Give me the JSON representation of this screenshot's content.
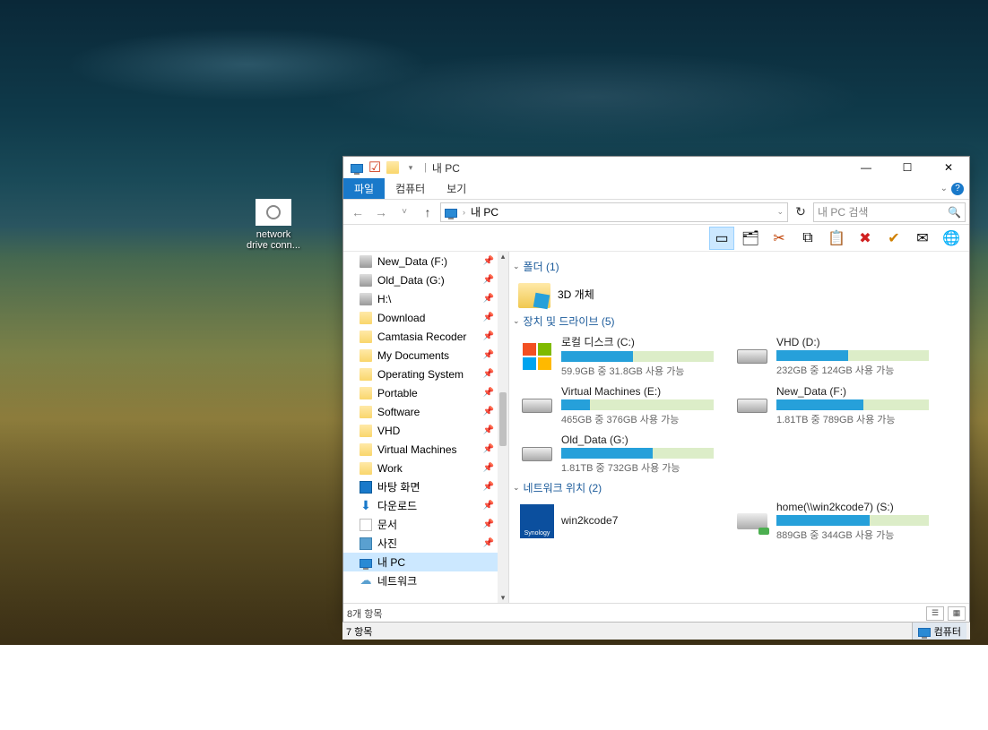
{
  "desktop": {
    "shortcut": {
      "label": "network\ndrive conn..."
    }
  },
  "window": {
    "title": "내 PC",
    "controls": {
      "min": "—",
      "max": "☐",
      "close": "✕"
    }
  },
  "ribbon": {
    "tabs": {
      "file": "파일",
      "computer": "컴퓨터",
      "view": "보기"
    }
  },
  "nav": {
    "back": "←",
    "forward": "→",
    "recent_chev": "˅",
    "up": "↑",
    "breadcrumb": "내 PC",
    "refresh": "↻",
    "search_placeholder": "내 PC 검색",
    "search_icon": "🔍"
  },
  "toolbar_icons": {
    "preview": "▭",
    "organize": "🗂",
    "cut": "✂",
    "copy": "⧉",
    "paste": "📋",
    "delete": "✖",
    "rename": "✔",
    "properties": "✉",
    "web": "🌐"
  },
  "sidebar": {
    "items": [
      {
        "label": "New_Data (F:)",
        "icon": "drive",
        "pin": true
      },
      {
        "label": "Old_Data (G:)",
        "icon": "drive",
        "pin": true
      },
      {
        "label": "H:\\",
        "icon": "drive",
        "pin": true
      },
      {
        "label": "Download",
        "icon": "folder",
        "pin": true
      },
      {
        "label": "Camtasia Recoder",
        "icon": "folder",
        "pin": true
      },
      {
        "label": "My Documents",
        "icon": "folder",
        "pin": true
      },
      {
        "label": "Operating System",
        "icon": "folder",
        "pin": true
      },
      {
        "label": "Portable",
        "icon": "folder",
        "pin": true
      },
      {
        "label": "Software",
        "icon": "folder",
        "pin": true
      },
      {
        "label": "VHD",
        "icon": "folder",
        "pin": true
      },
      {
        "label": "Virtual Machines",
        "icon": "folder",
        "pin": true
      },
      {
        "label": "Work",
        "icon": "folder",
        "pin": true
      },
      {
        "label": "바탕 화면",
        "icon": "desktop",
        "pin": true
      },
      {
        "label": "다운로드",
        "icon": "download",
        "pin": true
      },
      {
        "label": "문서",
        "icon": "doc",
        "pin": true
      },
      {
        "label": "사진",
        "icon": "pic",
        "pin": true
      },
      {
        "label": "내 PC",
        "icon": "pc",
        "pin": false,
        "selected": true
      },
      {
        "label": "네트워크",
        "icon": "net",
        "pin": false
      }
    ]
  },
  "content": {
    "groups": {
      "folders": {
        "title": "폴더 (1)",
        "items": [
          {
            "label": "3D 개체"
          }
        ]
      },
      "drives": {
        "title": "장치 및 드라이브 (5)",
        "items": [
          {
            "name": "로컬 디스크 (C:)",
            "stat": "59.9GB 중 31.8GB 사용 가능",
            "fill": 47,
            "icon": "win"
          },
          {
            "name": "VHD (D:)",
            "stat": "232GB 중 124GB 사용 가능",
            "fill": 47,
            "icon": "hdd"
          },
          {
            "name": "Virtual Machines (E:)",
            "stat": "465GB 중 376GB 사용 가능",
            "fill": 19,
            "icon": "hdd"
          },
          {
            "name": "New_Data (F:)",
            "stat": "1.81TB 중 789GB 사용 가능",
            "fill": 57,
            "icon": "hdd"
          },
          {
            "name": "Old_Data (G:)",
            "stat": "1.81TB 중 732GB 사용 가능",
            "fill": 60,
            "icon": "hdd"
          }
        ]
      },
      "network": {
        "title": "네트워크 위치 (2)",
        "items": [
          {
            "name": "win2kcode7",
            "stat": "",
            "fill": 0,
            "icon": "syn"
          },
          {
            "name": "home(\\\\win2kcode7) (S:)",
            "stat": "889GB 중 344GB 사용 가능",
            "fill": 61,
            "icon": "net"
          }
        ]
      }
    }
  },
  "statusbar": {
    "items": "8개 항목"
  },
  "taskbar": {
    "left": "7 항목",
    "right": "컴퓨터"
  }
}
